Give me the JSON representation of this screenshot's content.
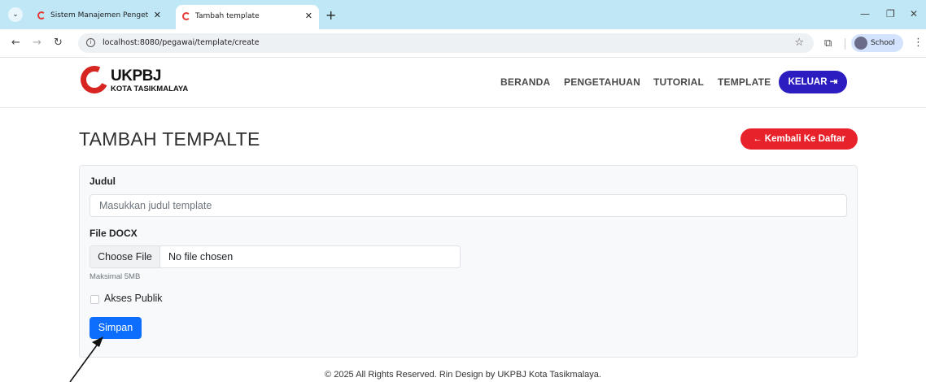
{
  "browser": {
    "tabs": [
      {
        "title": "Sistem Manajemen Pengetahuan",
        "active": false
      },
      {
        "title": "Tambah template",
        "active": true
      }
    ],
    "url": "localhost:8080/pegawai/template/create",
    "profile_name": "School"
  },
  "header": {
    "logo_title": "UKPBJ",
    "logo_subtitle": "KOTA TASIKMALAYA",
    "menu": [
      "BERANDA",
      "PENGETAHUAN",
      "TUTORIAL",
      "TEMPLATE"
    ],
    "logout_label": "KELUAR ⇥"
  },
  "page": {
    "title": "TAMBAH TEMPALTE",
    "back_label": "← Kembali Ke Daftar"
  },
  "form": {
    "judul_label": "Judul",
    "judul_placeholder": "Masukkan judul template",
    "file_label": "File DOCX",
    "choose_label": "Choose File",
    "file_status": "No file chosen",
    "file_hint": "Maksimal 5MB",
    "public_label": "Akses Publik",
    "public_checked": false,
    "submit_label": "Simpan"
  },
  "footer": {
    "text": "© 2025 All Rights Reserved. Rin Design by UKPBJ Kota Tasikmalaya."
  },
  "colors": {
    "brand_red": "#e8222a",
    "brand_blue": "#2b1dbf",
    "primary": "#0d6efd",
    "tabstrip": "#bfe7f6"
  }
}
